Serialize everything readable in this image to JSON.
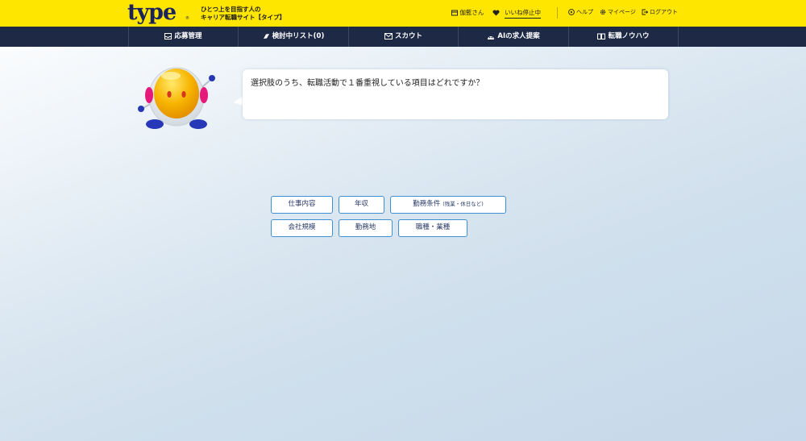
{
  "header": {
    "logo": "type",
    "logo_mark": "®",
    "tagline_line1": "ひとつ上を目指す人の",
    "tagline_line2": "キャリア転職サイト【タイプ】",
    "user_name": "伽藍さん",
    "pause_link": "いいね停止中",
    "help": "ヘルプ",
    "mypage": "マイページ",
    "logout": "ログアウト"
  },
  "nav": {
    "items": [
      {
        "label": "応募管理",
        "icon": "inbox-icon"
      },
      {
        "label": "検討中リスト(0)",
        "icon": "bookmark-icon"
      },
      {
        "label": "スカウト",
        "icon": "mail-icon"
      },
      {
        "label": "AIの求人提案",
        "icon": "robot-icon"
      },
      {
        "label": "転職ノウハウ",
        "icon": "book-icon"
      }
    ]
  },
  "question": {
    "text": "選択肢のうち、転職活動で１番重視している項目はどれですか？"
  },
  "choices": [
    {
      "label": "仕事内容",
      "note": ""
    },
    {
      "label": "年収",
      "note": ""
    },
    {
      "label": "勤務条件",
      "note": "(残業・休日など)"
    },
    {
      "label": "会社規模",
      "note": ""
    },
    {
      "label": "勤務地",
      "note": ""
    },
    {
      "label": "職種・業種",
      "note": ""
    }
  ],
  "colors": {
    "header_bg": "#ffe600",
    "nav_bg": "#1e2a45",
    "choice_border": "#3d8fd6",
    "logo": "#1a2260"
  }
}
